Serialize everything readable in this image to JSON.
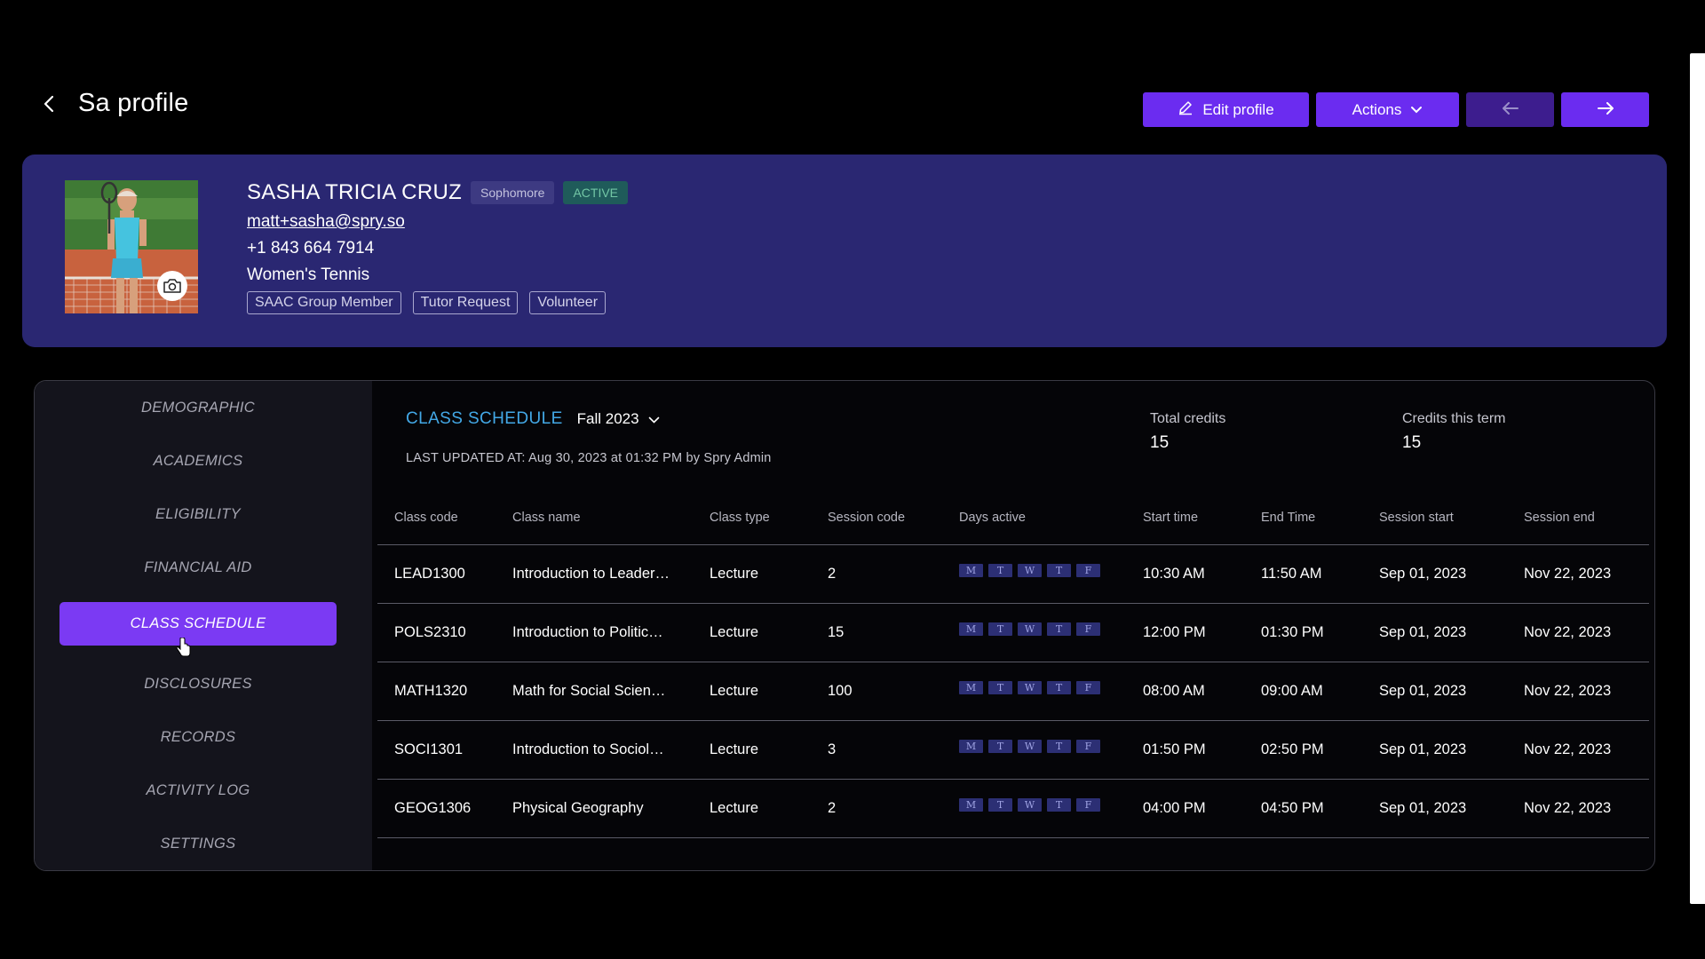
{
  "header": {
    "title": "Sa profile",
    "buttons": {
      "edit": "Edit profile",
      "actions": "Actions"
    }
  },
  "profile": {
    "name": "SASHA TRICIA CRUZ",
    "year": "Sophomore",
    "status": "ACTIVE",
    "email": "matt+sasha@spry.so",
    "phone": "+1 843 664 7914",
    "sport": "Women's Tennis",
    "tags": [
      "SAAC Group Member",
      "Tutor Request",
      "Volunteer"
    ]
  },
  "sidebar": {
    "items": [
      {
        "label": "DEMOGRAPHIC"
      },
      {
        "label": "ACADEMICS"
      },
      {
        "label": "ELIGIBILITY"
      },
      {
        "label": "FINANCIAL AID"
      },
      {
        "label": "CLASS SCHEDULE"
      },
      {
        "label": "DISCLOSURES"
      },
      {
        "label": "RECORDS"
      },
      {
        "label": "ACTIVITY LOG"
      },
      {
        "label": "SETTINGS"
      }
    ],
    "active": "CLASS SCHEDULE"
  },
  "schedule": {
    "title": "CLASS SCHEDULE",
    "term": "Fall 2023",
    "last_updated": "LAST UPDATED AT: Aug 30, 2023 at 01:32 PM by Spry Admin",
    "total_credits_label": "Total credits",
    "total_credits": "15",
    "term_credits_label": "Credits this term",
    "term_credits": "15",
    "columns": [
      "Class code",
      "Class name",
      "Class type",
      "Session code",
      "Days active",
      "Start time",
      "End Time",
      "Session start",
      "Session end"
    ],
    "day_letters": [
      "M",
      "T",
      "W",
      "T",
      "F"
    ],
    "rows": [
      {
        "code": "LEAD1300",
        "name": "Introduction to Leadership",
        "type": "Lecture",
        "session": "2",
        "start": "10:30 AM",
        "end": "11:50 AM",
        "session_start": "Sep 01, 2023",
        "session_end": "Nov 22, 2023"
      },
      {
        "code": "POLS2310",
        "name": "Introduction to Political Science",
        "type": "Lecture",
        "session": "15",
        "start": "12:00 PM",
        "end": "01:30 PM",
        "session_start": "Sep 01, 2023",
        "session_end": "Nov 22, 2023"
      },
      {
        "code": "MATH1320",
        "name": "Math for Social Sciences",
        "type": "Lecture",
        "session": "100",
        "start": "08:00 AM",
        "end": "09:00 AM",
        "session_start": "Sep 01, 2023",
        "session_end": "Nov 22, 2023"
      },
      {
        "code": "SOCI1301",
        "name": "Introduction to Sociology",
        "type": "Lecture",
        "session": "3",
        "start": "01:50 PM",
        "end": "02:50 PM",
        "session_start": "Sep 01, 2023",
        "session_end": "Nov 22, 2023"
      },
      {
        "code": "GEOG1306",
        "name": "Physical Geography",
        "type": "Lecture",
        "session": "2",
        "start": "04:00 PM",
        "end": "04:50 PM",
        "session_start": "Sep 01, 2023",
        "session_end": "Nov 22, 2023"
      }
    ]
  },
  "colors": {
    "accent": "#6b2cf0",
    "card_bg": "#2a2772",
    "schedule_title": "#43a8e6",
    "active_badge": "#1f5b5a"
  }
}
